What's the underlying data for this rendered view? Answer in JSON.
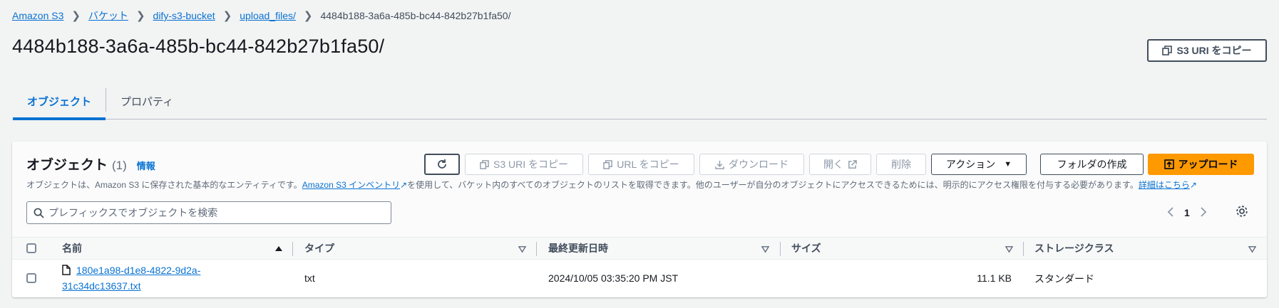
{
  "breadcrumb": {
    "items": [
      "Amazon S3",
      "バケット",
      "dify-s3-bucket",
      "upload_files/"
    ],
    "current": "4484b188-3a6a-485b-bc44-842b27b1fa50/"
  },
  "page_title": "4484b188-3a6a-485b-bc44-842b27b1fa50/",
  "copy_uri_top_label": "S3 URI をコピー",
  "tabs": [
    {
      "label": "オブジェクト",
      "active": true
    },
    {
      "label": "プロパティ",
      "active": false
    }
  ],
  "panel": {
    "title": "オブジェクト",
    "count": "(1)",
    "info": "情報",
    "desc_before": "オブジェクトは、Amazon S3 に保存された基本的なエンティティです。",
    "desc_link": "Amazon S3 インベントリ",
    "desc_after": "を使用して、バケット内のすべてのオブジェクトのリストを取得できます。他のユーザーが自分のオブジェクトにアクセスできるためには、明示的にアクセス権限を付与する必要があります。",
    "desc_link2": "詳細はこちら"
  },
  "toolbar": {
    "copy_s3_uri": "S3 URI をコピー",
    "copy_url": "URL をコピー",
    "download": "ダウンロード",
    "open": "開く",
    "delete": "削除",
    "actions": "アクション",
    "create_folder": "フォルダの作成",
    "upload": "アップロード"
  },
  "search": {
    "placeholder": "プレフィックスでオブジェクトを検索",
    "value": ""
  },
  "pagination": {
    "page": "1"
  },
  "table": {
    "columns": [
      "名前",
      "タイプ",
      "最終更新日時",
      "サイズ",
      "ストレージクラス"
    ],
    "rows": [
      {
        "name_line1": "180e1a98-d1e8-4822-9d2a-",
        "name_line2": "31c34dc13637.txt",
        "type": "txt",
        "modified": "2024/10/05 03:35:20 PM JST",
        "size": "11.1 KB",
        "storage": "スタンダード"
      }
    ]
  },
  "colors": {
    "link": "#0972d3",
    "primary": "#ff9900",
    "background": "#f2f3f3"
  }
}
